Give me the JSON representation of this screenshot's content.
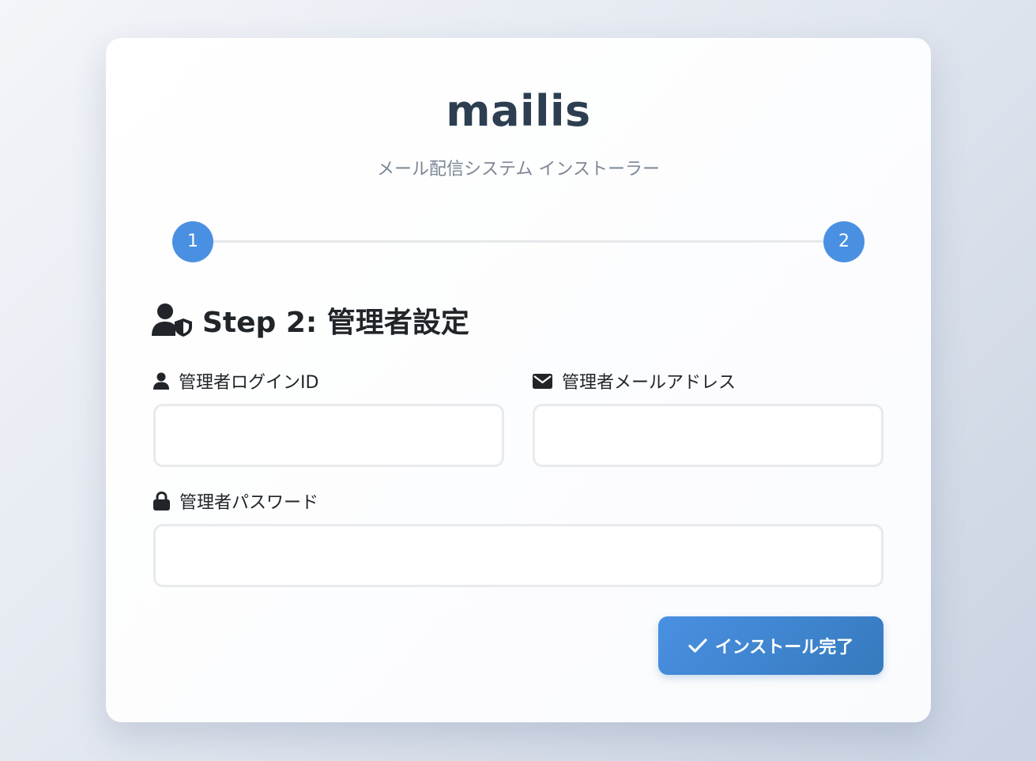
{
  "brand": {
    "name": "mailis",
    "subtitle": "メール配信システム インストーラー"
  },
  "stepper": {
    "steps": [
      {
        "label": "1"
      },
      {
        "label": "2"
      }
    ],
    "current": 2
  },
  "section": {
    "title": "Step 2: 管理者設定",
    "icon": "user-shield-icon"
  },
  "form": {
    "login_id": {
      "label": "管理者ログインID",
      "icon": "user-icon",
      "value": ""
    },
    "email": {
      "label": "管理者メールアドレス",
      "icon": "envelope-icon",
      "value": ""
    },
    "password": {
      "label": "管理者パスワード",
      "icon": "lock-icon",
      "value": ""
    },
    "submit_label": "インストール完了",
    "submit_icon": "check-icon"
  },
  "colors": {
    "accent": "#4a90e2",
    "accent_dark": "#357abd",
    "brand_text": "#2c3e50"
  }
}
